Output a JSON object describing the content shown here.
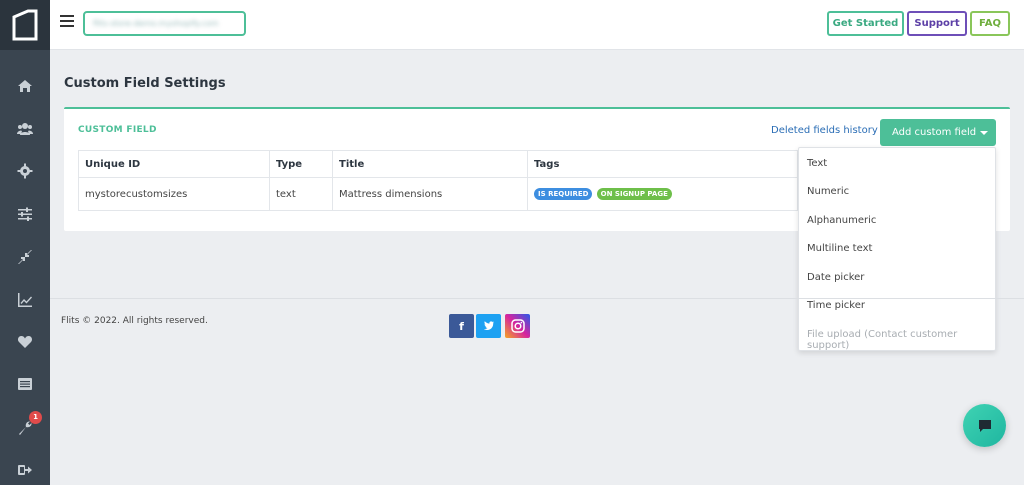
{
  "topbar": {
    "store_name": "flits-store-demo.myshopify.com",
    "get_started": "Get Started",
    "support": "Support",
    "faq": "FAQ"
  },
  "sidebar": {
    "items": [
      {
        "icon": "home-icon"
      },
      {
        "icon": "users-icon"
      },
      {
        "icon": "gear-icon"
      },
      {
        "icon": "sliders-icon"
      },
      {
        "icon": "compress-icon"
      },
      {
        "icon": "chart-icon"
      },
      {
        "icon": "heart-icon"
      },
      {
        "icon": "list-icon"
      },
      {
        "icon": "wrench-icon",
        "badge": "1"
      },
      {
        "icon": "logout-icon"
      }
    ]
  },
  "page": {
    "title": "Custom Field Settings",
    "card_label": "CUSTOM FIELD",
    "deleted_history": "Deleted fields history",
    "add_button": "Add custom field"
  },
  "table": {
    "headers": [
      "Unique ID",
      "Type",
      "Title",
      "Tags"
    ],
    "rows": [
      {
        "id": "mystorecustomsizes",
        "type": "text",
        "title": "Mattress dimensions",
        "tags": [
          "IS REQUIRED",
          "ON SIGNUP PAGE"
        ]
      }
    ]
  },
  "dropdown": {
    "items": [
      "Text",
      "Numeric",
      "Alphanumeric",
      "Multiline text",
      "Date picker",
      "Time picker"
    ],
    "disabled_item": "File upload (Contact customer support)"
  },
  "footer": {
    "copyright": "Flits © 2022. All rights reserved.",
    "facebook": "f",
    "twitter": "t"
  },
  "colors": {
    "accent": "#4dbf98",
    "sidebar": "#3a4550",
    "support": "#6e4fb8",
    "faq": "#8ac65a",
    "link": "#2a6db5"
  }
}
